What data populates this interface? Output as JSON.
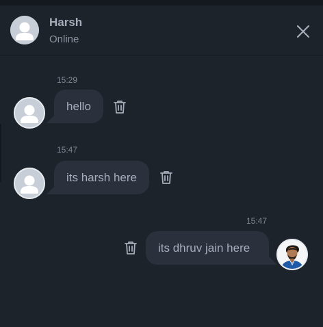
{
  "header": {
    "name": "Harsh",
    "status": "Online",
    "avatar_icon": "default-user-avatar",
    "close_icon": "close-icon"
  },
  "messages": [
    {
      "time": "15:29",
      "text": "hello",
      "side": "left",
      "avatar_icon": "default-user-avatar",
      "action_icon": "trash-icon"
    },
    {
      "time": "15:47",
      "text": "its harsh here",
      "side": "left",
      "avatar_icon": "default-user-avatar",
      "action_icon": "trash-icon"
    },
    {
      "time": "15:47",
      "text": "its dhruv jain here",
      "side": "right",
      "avatar_icon": "user-photo-avatar",
      "action_icon": "trash-icon"
    }
  ],
  "colors": {
    "background": "#1d232a",
    "bubble": "#2a313c",
    "text": "#a7adba",
    "muted": "#8d94a1"
  }
}
